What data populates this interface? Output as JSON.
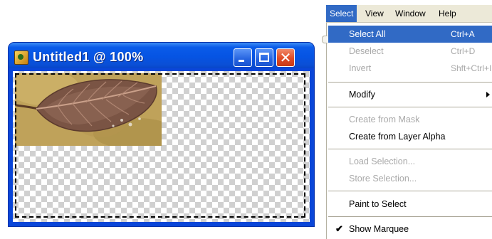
{
  "image_window": {
    "title": "Untitled1 @ 100%",
    "buttons": {
      "minimize": "minimize",
      "maximize": "maximize",
      "close": "✕"
    }
  },
  "menubar": {
    "items": [
      {
        "label": "Select",
        "active": true
      },
      {
        "label": "View",
        "active": false
      },
      {
        "label": "Window",
        "active": false
      },
      {
        "label": "Help",
        "active": false
      }
    ]
  },
  "select_menu": {
    "items": [
      {
        "label": "Select All",
        "shortcut": "Ctrl+A",
        "state": "selected"
      },
      {
        "label": "Deselect",
        "shortcut": "Ctrl+D",
        "state": "disabled"
      },
      {
        "label": "Invert",
        "shortcut": "Shft+Ctrl+I",
        "state": "disabled"
      },
      {
        "label": "Modify",
        "shortcut": "",
        "state": "submenu"
      },
      {
        "label": "Create from Mask",
        "shortcut": "",
        "state": "disabled"
      },
      {
        "label": "Create from Layer Alpha",
        "shortcut": "",
        "state": "enabled"
      },
      {
        "label": "Load Selection...",
        "shortcut": "",
        "state": "disabled"
      },
      {
        "label": "Store Selection...",
        "shortcut": "",
        "state": "disabled"
      },
      {
        "label": "Paint to Select",
        "shortcut": "",
        "state": "enabled"
      },
      {
        "label": "Show Marquee",
        "shortcut": "",
        "state": "checked"
      }
    ],
    "check_glyph": "✔"
  },
  "colors": {
    "menu_highlight": "#316ac5",
    "titlebar_blue": "#0a5be9",
    "close_red": "#e04b25",
    "disabled_text": "#a9a9a9"
  }
}
